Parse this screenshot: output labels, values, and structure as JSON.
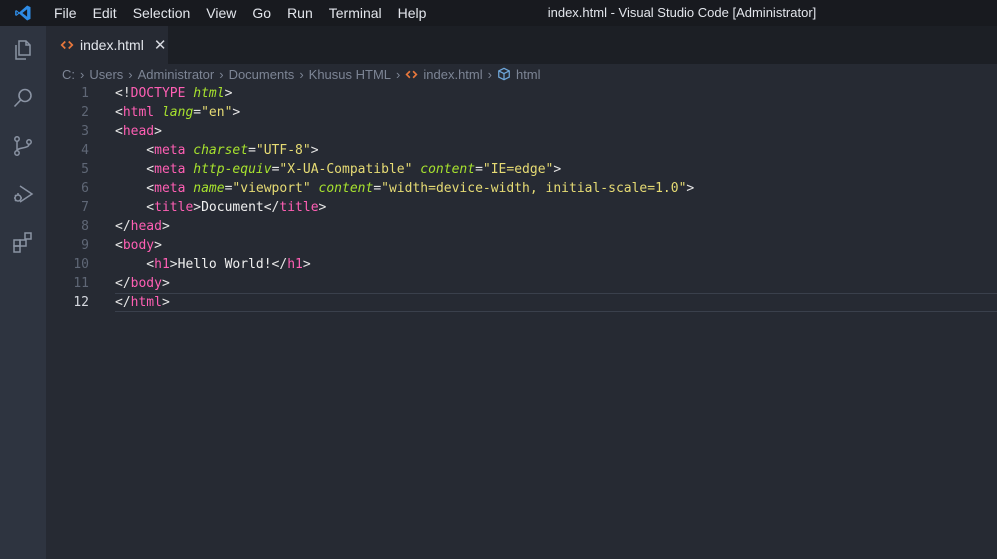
{
  "titlebar": {
    "menu": [
      "File",
      "Edit",
      "Selection",
      "View",
      "Go",
      "Run",
      "Terminal",
      "Help"
    ],
    "window_title": "index.html - Visual Studio Code [Administrator]"
  },
  "activitybar": {
    "icons": [
      "explorer-icon",
      "search-icon",
      "source-control-icon",
      "run-debug-icon",
      "extensions-icon"
    ]
  },
  "tab": {
    "label": "index.html",
    "close": "✕"
  },
  "breadcrumb": {
    "items": [
      "C:",
      "Users",
      "Administrator",
      "Documents",
      "Khusus HTML",
      "index.html",
      "html"
    ],
    "separator": "›"
  },
  "colors": {
    "tag": "#ff5fb4",
    "attribute": "#a7e22e",
    "string": "#e6db74",
    "punctuation": "#e6e6e6",
    "background": "#262a33"
  },
  "code": {
    "lines": [
      {
        "number": "1",
        "tokens": [
          [
            "p",
            "<!"
          ],
          [
            "d",
            "DOCTYPE"
          ],
          [
            "p",
            " "
          ],
          [
            "di",
            "html"
          ],
          [
            "p",
            ">"
          ]
        ]
      },
      {
        "number": "2",
        "tokens": [
          [
            "p",
            "<"
          ],
          [
            "t",
            "html"
          ],
          [
            "p",
            " "
          ],
          [
            "a",
            "lang"
          ],
          [
            "p",
            "="
          ],
          [
            "s",
            "\"en\""
          ],
          [
            "p",
            ">"
          ]
        ]
      },
      {
        "number": "3",
        "tokens": [
          [
            "p",
            "<"
          ],
          [
            "t",
            "head"
          ],
          [
            "p",
            ">"
          ]
        ]
      },
      {
        "number": "4",
        "tokens": [
          [
            "p",
            "    <"
          ],
          [
            "t",
            "meta"
          ],
          [
            "p",
            " "
          ],
          [
            "a",
            "charset"
          ],
          [
            "p",
            "="
          ],
          [
            "s",
            "\"UTF-8\""
          ],
          [
            "p",
            ">"
          ]
        ]
      },
      {
        "number": "5",
        "tokens": [
          [
            "p",
            "    <"
          ],
          [
            "t",
            "meta"
          ],
          [
            "p",
            " "
          ],
          [
            "a",
            "http-equiv"
          ],
          [
            "p",
            "="
          ],
          [
            "s",
            "\"X-UA-Compatible\""
          ],
          [
            "p",
            " "
          ],
          [
            "a",
            "content"
          ],
          [
            "p",
            "="
          ],
          [
            "s",
            "\"IE=edge\""
          ],
          [
            "p",
            ">"
          ]
        ]
      },
      {
        "number": "6",
        "tokens": [
          [
            "p",
            "    <"
          ],
          [
            "t",
            "meta"
          ],
          [
            "p",
            " "
          ],
          [
            "a",
            "name"
          ],
          [
            "p",
            "="
          ],
          [
            "s",
            "\"viewport\""
          ],
          [
            "p",
            " "
          ],
          [
            "a",
            "content"
          ],
          [
            "p",
            "="
          ],
          [
            "s",
            "\"width=device-width, initial-scale=1.0\""
          ],
          [
            "p",
            ">"
          ]
        ]
      },
      {
        "number": "7",
        "tokens": [
          [
            "p",
            "    <"
          ],
          [
            "t",
            "title"
          ],
          [
            "p",
            ">"
          ],
          [
            "tx",
            "Document"
          ],
          [
            "p",
            "</"
          ],
          [
            "t",
            "title"
          ],
          [
            "p",
            ">"
          ]
        ]
      },
      {
        "number": "8",
        "tokens": [
          [
            "p",
            "</"
          ],
          [
            "t",
            "head"
          ],
          [
            "p",
            ">"
          ]
        ]
      },
      {
        "number": "9",
        "tokens": [
          [
            "p",
            "<"
          ],
          [
            "t",
            "body"
          ],
          [
            "p",
            ">"
          ]
        ]
      },
      {
        "number": "10",
        "tokens": [
          [
            "p",
            "    <"
          ],
          [
            "t",
            "h1"
          ],
          [
            "p",
            ">"
          ],
          [
            "tx",
            "Hello World!"
          ],
          [
            "p",
            "</"
          ],
          [
            "t",
            "h1"
          ],
          [
            "p",
            ">"
          ]
        ]
      },
      {
        "number": "11",
        "tokens": [
          [
            "p",
            "</"
          ],
          [
            "t",
            "body"
          ],
          [
            "p",
            ">"
          ]
        ]
      },
      {
        "number": "12",
        "tokens": [
          [
            "p",
            "</"
          ],
          [
            "t",
            "html"
          ],
          [
            "p",
            ">"
          ]
        ],
        "current": true
      }
    ]
  }
}
